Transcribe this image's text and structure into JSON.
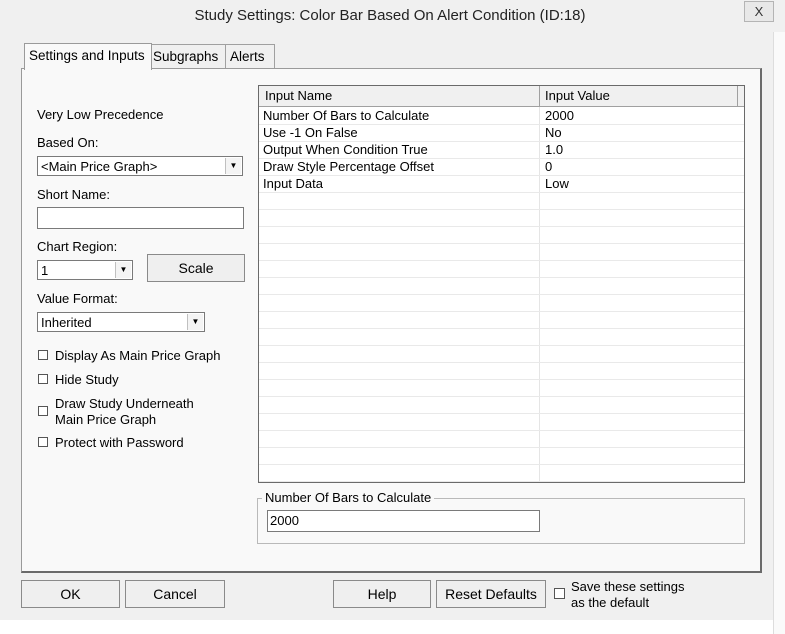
{
  "window": {
    "title": "Study Settings: Color Bar Based On Alert Condition (ID:18)",
    "close_label": "X"
  },
  "tabs": [
    {
      "label": "Settings and Inputs",
      "active": true
    },
    {
      "label": "Subgraphs",
      "active": false
    },
    {
      "label": "Alerts",
      "active": false
    }
  ],
  "left": {
    "precedence": "Very Low Precedence",
    "based_on_label": "Based On:",
    "based_on_value": "<Main Price Graph>",
    "short_name_label": "Short Name:",
    "short_name_value": "",
    "chart_region_label": "Chart Region:",
    "chart_region_value": "1",
    "scale_button": "Scale",
    "value_format_label": "Value Format:",
    "value_format_value": "Inherited",
    "checkboxes": {
      "display_main": "Display As Main Price Graph",
      "hide_study": "Hide Study",
      "draw_underneath_1": "Draw Study Underneath",
      "draw_underneath_2": "Main Price Graph",
      "protect": "Protect with Password"
    }
  },
  "inputs_table": {
    "columns": [
      "Input Name",
      "Input Value"
    ],
    "rows": [
      {
        "name": "Number Of Bars to Calculate",
        "value": "2000"
      },
      {
        "name": "Use -1 On False",
        "value": "No"
      },
      {
        "name": "Output When Condition True",
        "value": "1.0"
      },
      {
        "name": "Draw Style Percentage Offset",
        "value": "0"
      },
      {
        "name": "Input Data",
        "value": "Low"
      }
    ]
  },
  "editor": {
    "label": "Number Of Bars to Calculate",
    "value": "2000"
  },
  "footer": {
    "ok": "OK",
    "cancel": "Cancel",
    "help": "Help",
    "reset": "Reset Defaults",
    "save_default_1": "Save these settings",
    "save_default_2": "as the default"
  }
}
